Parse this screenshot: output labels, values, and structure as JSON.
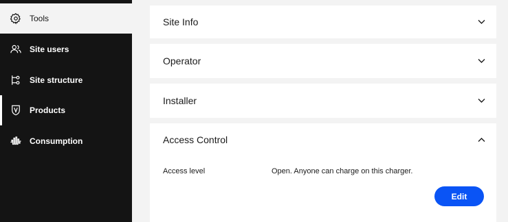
{
  "sidebar": {
    "items": [
      {
        "label": "Tools",
        "icon": "gear-icon"
      },
      {
        "label": "Site users",
        "icon": "users-icon"
      },
      {
        "label": "Site structure",
        "icon": "site-structure-icon"
      },
      {
        "label": "Products",
        "icon": "product-shield-icon"
      },
      {
        "label": "Consumption",
        "icon": "consumption-wave-icon"
      }
    ]
  },
  "sections": [
    {
      "title": "Site Info",
      "expanded": false
    },
    {
      "title": "Operator",
      "expanded": false
    },
    {
      "title": "Installer",
      "expanded": false
    },
    {
      "title": "Access Control",
      "expanded": true
    }
  ],
  "access_control": {
    "label": "Access level",
    "value": "Open. Anyone can charge on this charger.",
    "edit_label": "Edit"
  },
  "colors": {
    "sidebar_bg": "#141414",
    "page_bg": "#f3f3f3",
    "accent": "#0a54f5"
  }
}
